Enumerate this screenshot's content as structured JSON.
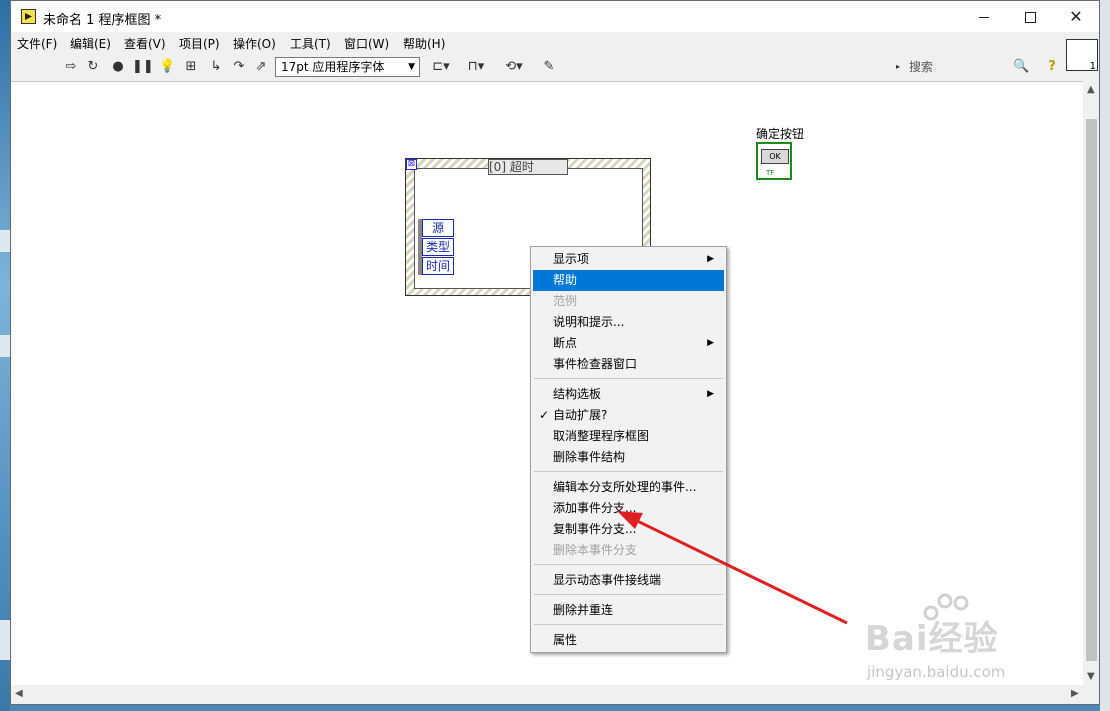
{
  "window": {
    "title": "未命名 1 程序框图 *"
  },
  "menubar": {
    "items": [
      "文件(F)",
      "编辑(E)",
      "查看(V)",
      "项目(P)",
      "操作(O)",
      "工具(T)",
      "窗口(W)",
      "帮助(H)"
    ]
  },
  "toolbar": {
    "font": "17pt 应用程序字体",
    "search_placeholder": "搜索",
    "vi_icon_number": "1"
  },
  "event_structure": {
    "case_label": "[0] 超时",
    "event_data": [
      "源",
      "类型",
      "时间"
    ]
  },
  "ok_terminal": {
    "label": "确定按钮",
    "button_text": "OK",
    "type_text": "TF"
  },
  "context_menu": {
    "items": [
      {
        "label": "显示项",
        "submenu": true
      },
      {
        "label": "帮助",
        "highlighted": true
      },
      {
        "label": "范例",
        "disabled": true
      },
      {
        "label": "说明和提示..."
      },
      {
        "label": "断点",
        "submenu": true
      },
      {
        "label": "事件检查器窗口"
      },
      {
        "label": "结构选板",
        "submenu": true
      },
      {
        "label": "自动扩展?",
        "checked": true
      },
      {
        "label": "取消整理程序框图"
      },
      {
        "label": "删除事件结构"
      },
      {
        "label": "编辑本分支所处理的事件..."
      },
      {
        "label": "添加事件分支..."
      },
      {
        "label": "复制事件分支..."
      },
      {
        "label": "删除本事件分支",
        "disabled": true
      },
      {
        "label": "显示动态事件接线端"
      },
      {
        "label": "删除并重连"
      },
      {
        "label": "属性"
      }
    ]
  },
  "watermark": {
    "brand": "Bai经验",
    "url": "jingyan.baidu.com"
  },
  "colors": {
    "highlight": "#0078d7",
    "annotation_arrow": "#e02020",
    "terminal_border": "#1a8a1a"
  }
}
